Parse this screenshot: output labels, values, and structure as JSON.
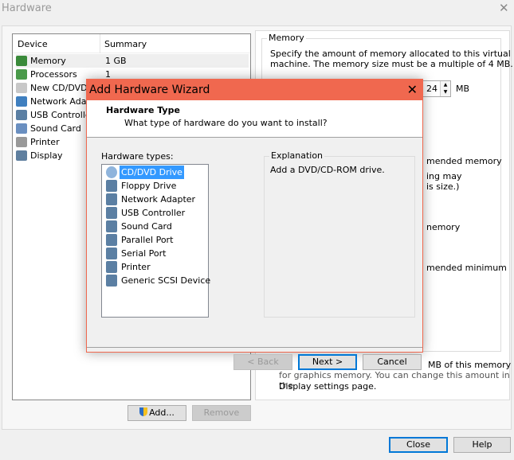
{
  "window": {
    "title": "Hardware",
    "close": "✕"
  },
  "devices": {
    "headers": [
      "Device",
      "Summary"
    ],
    "rows": [
      {
        "name": "Memory",
        "summary": "1 GB",
        "icon": "memory-icon"
      },
      {
        "name": "Processors",
        "summary": "1",
        "icon": "processor-icon"
      },
      {
        "name": "New CD/DVD (",
        "summary": "",
        "icon": "cd-icon"
      },
      {
        "name": "Network Adapt",
        "summary": "",
        "icon": "network-icon"
      },
      {
        "name": "USB Controller",
        "summary": "",
        "icon": "usb-icon"
      },
      {
        "name": "Sound Card",
        "summary": "",
        "icon": "sound-icon"
      },
      {
        "name": "Printer",
        "summary": "",
        "icon": "printer-icon"
      },
      {
        "name": "Display",
        "summary": "",
        "icon": "display-icon"
      }
    ]
  },
  "buttons": {
    "add": "Add...",
    "remove": "Remove",
    "close": "Close",
    "help": "Help"
  },
  "memory": {
    "group": "Memory",
    "desc1": "Specify the amount of memory allocated to this virtual",
    "desc2": "machine. The memory size must be a multiple of 4 MB.",
    "value_visible": "24",
    "unit": "MB",
    "frag1": "mended memory",
    "frag2": "ing may",
    "frag3": "is size.)",
    "frag4": "nemory",
    "frag5": "mended minimum",
    "frag6": "MB of this memory",
    "frag7": "for graphics memory. You can change this amount in the",
    "frag8": "Display settings page."
  },
  "wizard": {
    "title": "Add Hardware Wizard",
    "close": "✕",
    "heading": "Hardware Type",
    "subheading": "What type of hardware do you want to install?",
    "list_label": "Hardware types:",
    "types": [
      "CD/DVD Drive",
      "Floppy Drive",
      "Network Adapter",
      "USB Controller",
      "Sound Card",
      "Parallel Port",
      "Serial Port",
      "Printer",
      "Generic SCSI Device"
    ],
    "selected": "CD/DVD Drive",
    "explanation_label": "Explanation",
    "explanation": "Add a DVD/CD-ROM drive.",
    "back": "< Back",
    "next": "Next >",
    "cancel": "Cancel"
  },
  "colors": {
    "accent": "#f0684f",
    "selection": "#3399ff",
    "default_border": "#0078d7"
  }
}
